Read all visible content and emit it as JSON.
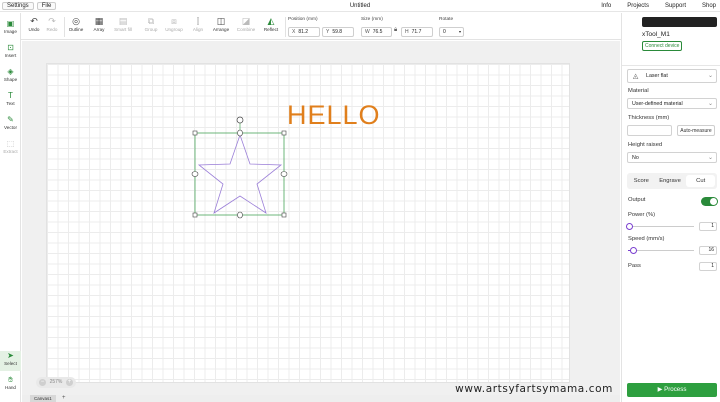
{
  "menubar": {
    "settings": "Settings",
    "file": "File",
    "title": "Untitled",
    "right": [
      "Info",
      "Projects",
      "Support",
      "Shop"
    ]
  },
  "toolbar": {
    "undo": "Undo",
    "redo": "Redo",
    "outline": "Outline",
    "array": "Array",
    "smart_fill": "Smart fill",
    "group": "Group",
    "ungroup": "Ungroup",
    "align": "Align",
    "arrange": "Arrange",
    "combine": "Combine",
    "reflect": "Reflect",
    "position_label": "Position (mm)",
    "pos_x_prefix": "X",
    "pos_x": "81.2",
    "pos_y_prefix": "Y",
    "pos_y": "59.8",
    "size_label": "Size (mm)",
    "size_w_prefix": "W",
    "size_w": "76.5",
    "size_h_prefix": "H",
    "size_h": "71.7",
    "rotate_label": "Rotate",
    "rotate": "0"
  },
  "sidebar": {
    "items": [
      {
        "label": "Image"
      },
      {
        "label": "Insert"
      },
      {
        "label": "Shape"
      },
      {
        "label": "Text"
      },
      {
        "label": "Vector"
      },
      {
        "label": "Extract"
      }
    ],
    "bottom": [
      {
        "label": "Select"
      },
      {
        "label": "Hand"
      }
    ]
  },
  "canvas": {
    "text": "HELLO",
    "zoom": "257%",
    "tab": "Canvas1",
    "add_tab": "+",
    "watermark": "www.artsyfartsymama.com"
  },
  "panel": {
    "device": "xTool_M1",
    "connect": "Connect device",
    "laser": "Laser flat",
    "material_label": "Material",
    "material": "User-defined material",
    "thickness_label": "Thickness (mm)",
    "auto_measure": "Auto-measure",
    "height_label": "Height raised",
    "height": "No",
    "modes": [
      "Score",
      "Engrave",
      "Cut"
    ],
    "active_mode": "Cut",
    "output_label": "Output",
    "power_label": "Power (%)",
    "power": "1",
    "power_fraction": 0.01,
    "speed_label": "Speed (mm/s)",
    "speed": "16",
    "speed_fraction": 0.08,
    "pass_label": "Pass",
    "pass": "1",
    "process": "Process"
  },
  "colors": {
    "accent": "#2e9f3f",
    "text_orange": "#e07f1c",
    "slider": "#7a3fd0",
    "star_stroke": "#9b7fd8"
  }
}
